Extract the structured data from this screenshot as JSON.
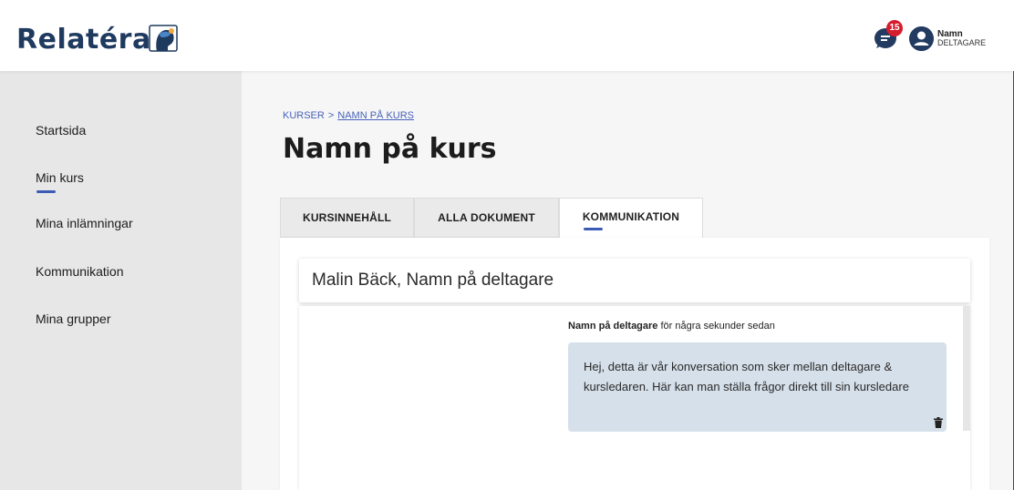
{
  "header": {
    "logo_text": "Relatéra",
    "notification_count": "15",
    "user_name": "Namn",
    "user_role": "DELTAGARE"
  },
  "sidebar": {
    "items": [
      {
        "label": "Startsida"
      },
      {
        "label": "Min kurs",
        "active": true
      },
      {
        "label": "Mina inlämningar"
      },
      {
        "label": "Kommunikation"
      },
      {
        "label": "Mina grupper"
      }
    ]
  },
  "breadcrumb": {
    "root": "KURSER",
    "separator": ">",
    "current": "NAMN PÅ KURS"
  },
  "page_title": "Namn på kurs",
  "tabs": [
    {
      "label": "KURSINNEHÅLL"
    },
    {
      "label": "ALLA DOKUMENT"
    },
    {
      "label": "KOMMUNIKATION",
      "active": true
    }
  ],
  "conversation": {
    "title": "Malin Bäck, Namn på deltagare",
    "messages": [
      {
        "sender": "Namn på deltagare",
        "time": "för några sekunder sedan",
        "text": "Hej, detta är vår konversation som sker mellan deltagare & kursledaren. Här kan man ställa frågor direkt till sin kursledare"
      }
    ]
  },
  "colors": {
    "brand": "#1f3a5f",
    "accent": "#3d5bb5",
    "badge": "#d51d2e",
    "bubble": "#d6e0ea"
  }
}
